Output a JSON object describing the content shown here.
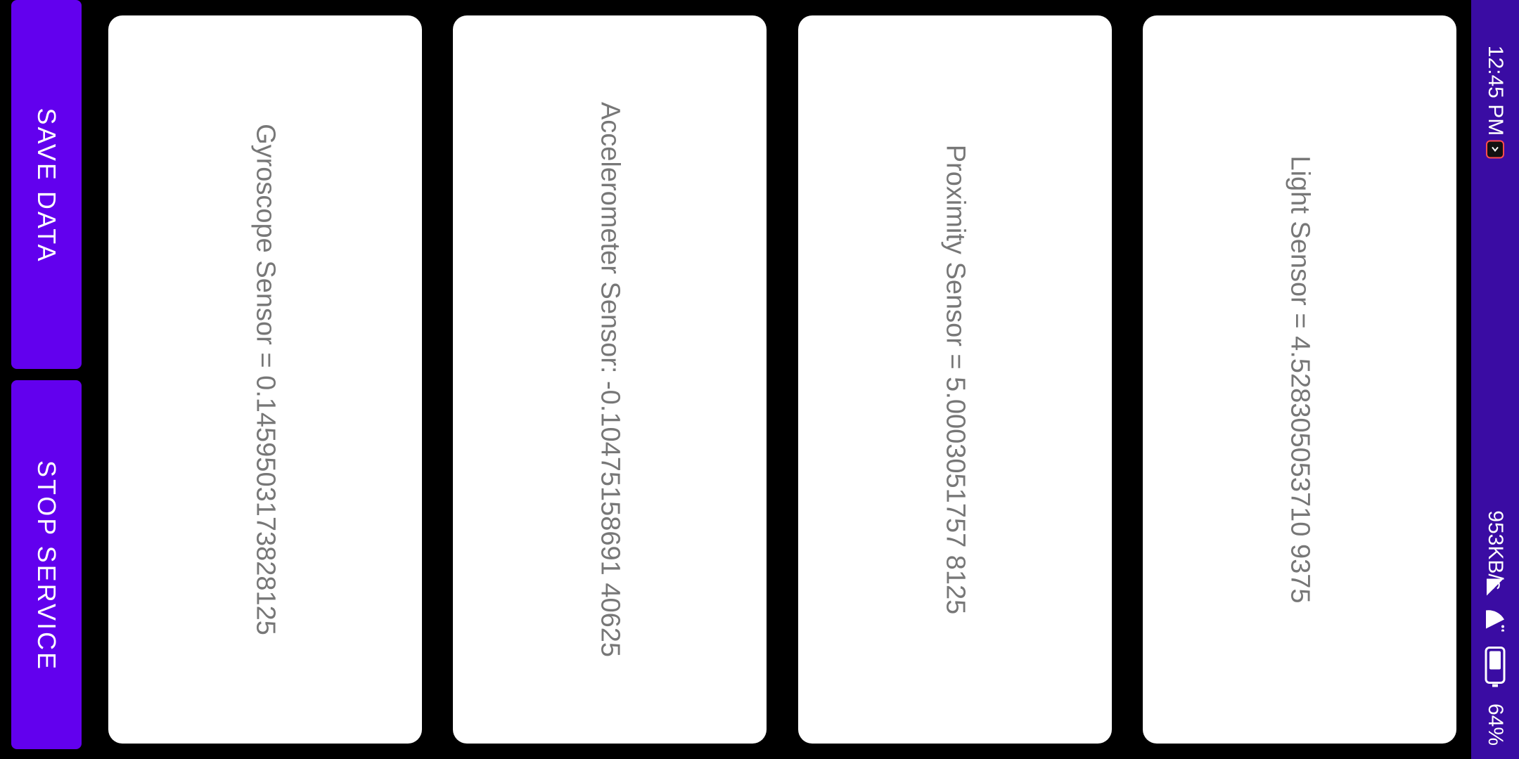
{
  "status_bar": {
    "time": "12:45 PM",
    "network_speed": "953KB/s",
    "battery_percent": "64%",
    "icons": [
      "notification-app-icon",
      "signal-icon",
      "wifi-icon",
      "battery-icon"
    ]
  },
  "actions": {
    "save_label": "SAVE DATA",
    "stop_label": "STOP SERVICE"
  },
  "sensors": [
    {
      "text": "Gyroscope Sensor = 0.1459503173828125"
    },
    {
      "text": "Accelerometer Sensor: -0.10475158691 40625"
    },
    {
      "text": "Proximity Sensor = 5.0003051757 8125"
    },
    {
      "text": "Light Sensor = 4.528305053710 9375"
    }
  ],
  "colors": {
    "status_bar_bg": "#3a0ca3",
    "button_bg": "#6200ee",
    "card_bg": "#ffffff",
    "card_text": "#777777",
    "background": "#000000"
  }
}
